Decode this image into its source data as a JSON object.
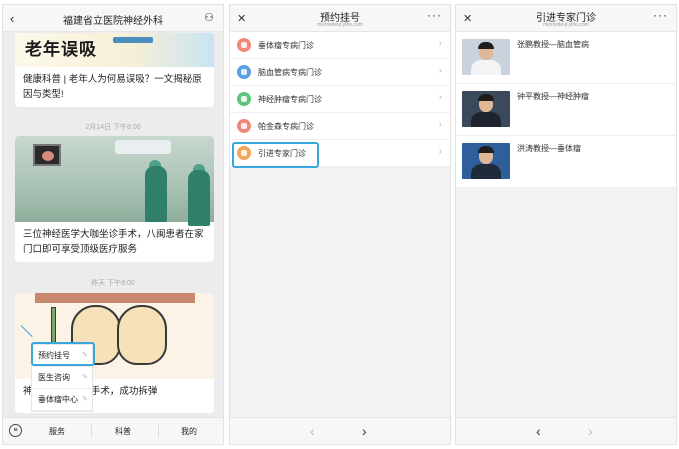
{
  "phone1": {
    "title": "福建省立医院神经外科",
    "card1": {
      "image_text": "老年误吸",
      "text": "健康科普 | 老年人为何易误吸？一文揭秘原因与类型!"
    },
    "time1": "2月14日 下午8:00",
    "card2": {
      "text": "三位神经医学大咖坐诊手术，八闽患者在家门口即可享受顶级医疗服务"
    },
    "time2": "昨天 下午8:00",
    "card3": {
      "text_visible": "\"手术，成功拆弹",
      "text_prefix": "神"
    },
    "popup_menu": [
      "预约挂号",
      "医生咨询",
      "垂体瘤中心"
    ],
    "tabs": [
      "服务",
      "科普",
      "我的"
    ],
    "tab_symbol": "≡"
  },
  "phone2": {
    "title": "预约挂号",
    "subtitle": "micrositeut.yiho.com",
    "items": [
      {
        "label": "垂体瘤专病门诊",
        "color": "#f08a78"
      },
      {
        "label": "脑血管病专病门诊",
        "color": "#5aa0e6"
      },
      {
        "label": "神经肿瘤专病门诊",
        "color": "#5fc47d"
      },
      {
        "label": "帕金森专病门诊",
        "color": "#f08a78"
      },
      {
        "label": "引进专家门诊",
        "color": "#f2a85a"
      }
    ],
    "nav_back": "‹",
    "nav_forward": "›"
  },
  "phone3": {
    "title": "引进专家门诊",
    "subtitle": "micrositeut.yiho.com",
    "experts": [
      {
        "name": "张鹏教授—脑血管病"
      },
      {
        "name": "钟平教授—神经肿瘤"
      },
      {
        "name": "洪涛教授—垂体瘤"
      }
    ],
    "nav_back": "‹",
    "nav_forward": "›"
  },
  "icons": {
    "close": "✕",
    "more": "···",
    "back": "‹",
    "chevron": "›",
    "person": "⚇",
    "edit": "✎"
  },
  "colors": {
    "highlight": "#3aa6de"
  }
}
